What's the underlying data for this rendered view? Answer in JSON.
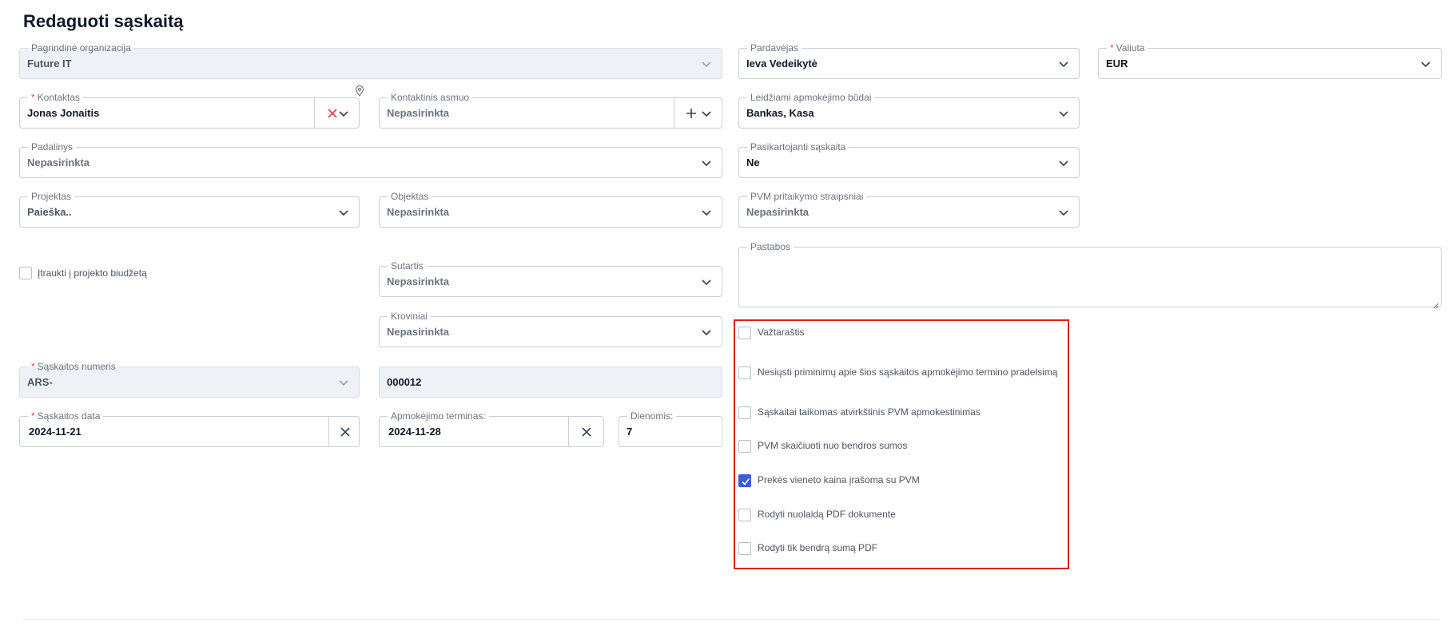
{
  "page": {
    "title": "Redaguoti sąskaitą"
  },
  "fields": {
    "organization": {
      "label": "Pagrindinė organizacija",
      "value": "Future IT"
    },
    "seller": {
      "label": "Pardavėjas",
      "value": "Ieva Vedeikytė"
    },
    "currency": {
      "label": "Valiuta",
      "value": "EUR",
      "required": "*"
    },
    "contact": {
      "label": "Kontaktas",
      "value": "Jonas Jonaitis",
      "required": "*"
    },
    "contact_person": {
      "label": "Kontaktinis asmuo",
      "value": "Nepasirinkta"
    },
    "payment_methods": {
      "label": "Leidžiami apmokėjimo būdai",
      "value": "Bankas, Kasa"
    },
    "division": {
      "label": "Padalinys",
      "value": "Nepasirinkta"
    },
    "recurring": {
      "label": "Pasikartojanti sąskaita",
      "value": "Ne"
    },
    "project": {
      "label": "Projektas",
      "value": "Paieška.."
    },
    "object": {
      "label": "Objektas",
      "value": "Nepasirinkta"
    },
    "vat_articles": {
      "label": "PVM pritaikymo straipsniai",
      "value": "Nepasirinkta"
    },
    "notes": {
      "label": "Pastabos",
      "value": ""
    },
    "contract": {
      "label": "Sutartis",
      "value": "Nepasirinkta"
    },
    "cargo": {
      "label": "Kroviniai",
      "value": "Nepasirinkta"
    },
    "invoice_series": {
      "label": "Sąskaitos numeris",
      "value": "ARS-",
      "required": "*"
    },
    "invoice_number": {
      "value": "000012"
    },
    "invoice_date": {
      "label": "Sąskaitos data",
      "value": "2024-11-21",
      "required": "*"
    },
    "payment_term": {
      "label": "Apmokėjimo terminas:",
      "value": "2024-11-28"
    },
    "days": {
      "label": "Dienomis:",
      "value": "7"
    }
  },
  "budget_checkbox": {
    "label": "Įtraukti į projekto biudžetą",
    "checked": false
  },
  "options": [
    {
      "label": "Važtaraštis",
      "checked": false
    },
    {
      "label": "Nesiųsti priminimų apie šios sąskaitos apmokėjimo termino pradelsimą",
      "checked": false
    },
    {
      "label": "Sąskaitai taikomas atvirkštinis PVM apmokestinimas",
      "checked": false
    },
    {
      "label": "PVM skaičiuoti nuo bendros sumos",
      "checked": false
    },
    {
      "label": "Prekės vieneto kaina įrašoma su PVM",
      "checked": true
    },
    {
      "label": "Rodyti nuolaidą PDF dokumente",
      "checked": false
    },
    {
      "label": "Rodyti tik bendrą sumą PDF",
      "checked": false
    }
  ],
  "colors": {
    "accent": "#3b5bdb",
    "highlight": "#e11d1d",
    "required": "#e5484d",
    "clear_red": "#e5484d"
  }
}
